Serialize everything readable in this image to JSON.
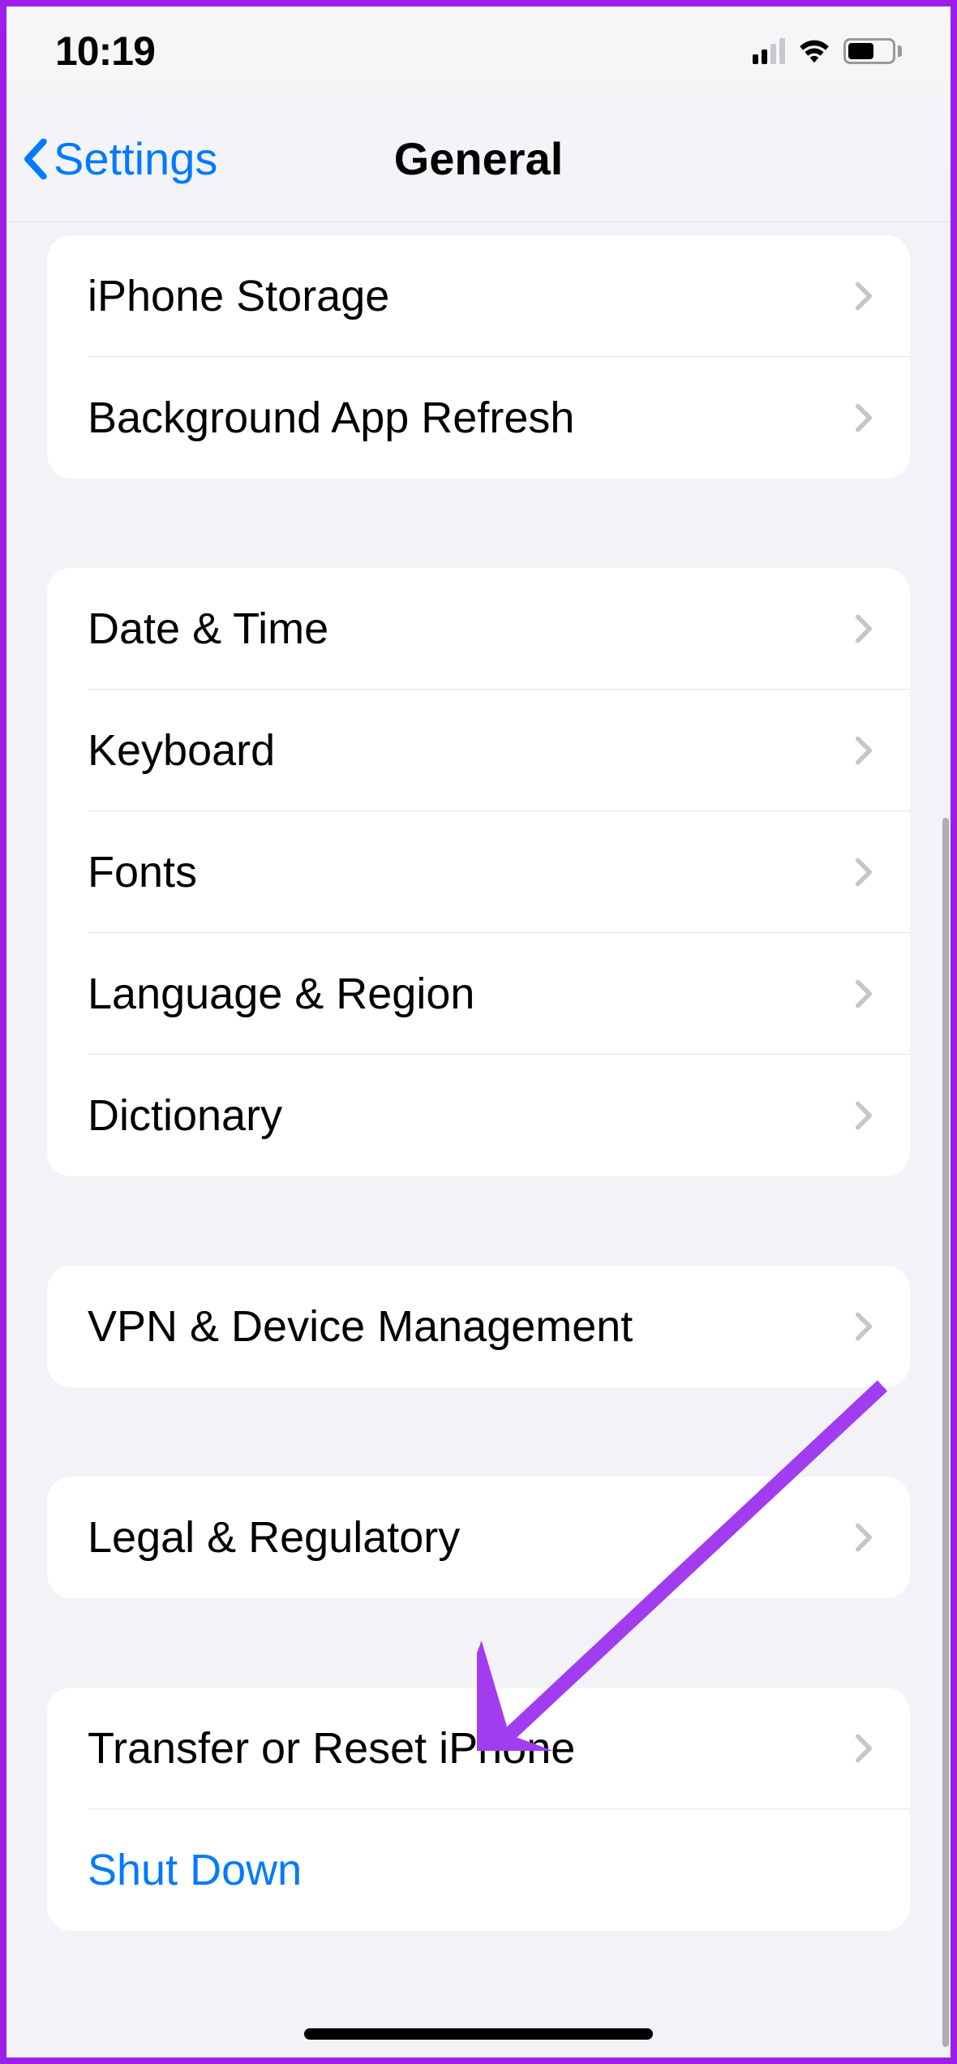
{
  "status": {
    "time": "10:19"
  },
  "nav": {
    "back": "Settings",
    "title": "General"
  },
  "sections": [
    {
      "rows": [
        {
          "label": "iPhone Storage",
          "type": "disclosure"
        },
        {
          "label": "Background App Refresh",
          "type": "disclosure"
        }
      ]
    },
    {
      "rows": [
        {
          "label": "Date & Time",
          "type": "disclosure"
        },
        {
          "label": "Keyboard",
          "type": "disclosure"
        },
        {
          "label": "Fonts",
          "type": "disclosure"
        },
        {
          "label": "Language & Region",
          "type": "disclosure"
        },
        {
          "label": "Dictionary",
          "type": "disclosure"
        }
      ]
    },
    {
      "rows": [
        {
          "label": "VPN & Device Management",
          "type": "disclosure"
        }
      ]
    },
    {
      "rows": [
        {
          "label": "Legal & Regulatory",
          "type": "disclosure"
        }
      ]
    },
    {
      "rows": [
        {
          "label": "Transfer or Reset iPhone",
          "type": "disclosure"
        },
        {
          "label": "Shut Down",
          "type": "link"
        }
      ]
    }
  ],
  "annotation": {
    "color": "#a23cf0"
  }
}
